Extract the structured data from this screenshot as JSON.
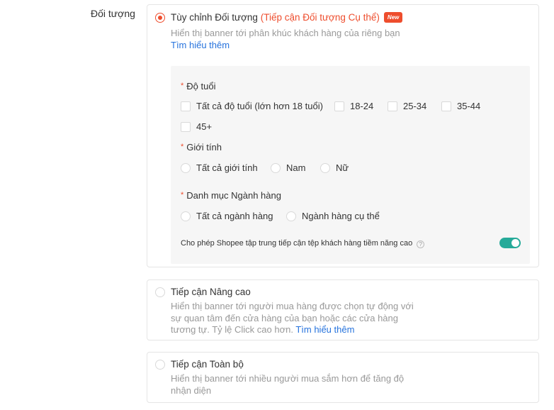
{
  "section_label": "Đối tượng",
  "option_custom": {
    "title_prefix": "Tùy chỉnh Đối tượng ",
    "title_accent": "(Tiếp cận Đối tượng Cụ thể)",
    "badge": "New",
    "description": "Hiển thị banner tới phân khúc khách hàng của riêng bạn",
    "link": "Tìm hiểu thêm",
    "age": {
      "label": "Độ tuổi",
      "options": [
        "Tất cả độ tuổi (lớn hơn 18 tuổi)",
        "18-24",
        "25-34",
        "35-44",
        "45+"
      ]
    },
    "gender": {
      "label": "Giới tính",
      "options": [
        "Tất cả giới tính",
        "Nam",
        "Nữ"
      ]
    },
    "category": {
      "label": "Danh mục Ngành hàng",
      "options": [
        "Tất cả ngành hàng",
        "Ngành hàng cụ thể"
      ]
    },
    "promo_text": "Cho phép Shopee tập trung tiếp cận tệp khách hàng tiềm năng cao",
    "help_glyph": "?",
    "required_mark": "*"
  },
  "option_advanced": {
    "title": "Tiếp cận Nâng cao",
    "desc_line1": "Hiển thị banner tới người mua hàng được chọn tự động với",
    "desc_line2": "sự quan tâm đến cửa hàng của bạn hoặc các cửa hàng",
    "desc_line3": "tương tự. Tỷ lệ Click cao hơn. ",
    "link": "Tìm hiểu thêm"
  },
  "option_all": {
    "title": "Tiếp cận Toàn bộ",
    "desc_line1": "Hiển thị banner tới nhiều người mua sắm hơn để tăng độ",
    "desc_line2": "nhận diện"
  },
  "colors": {
    "accent": "#ee4d2d",
    "link": "#2673dd",
    "toggle_on": "#26aa99"
  }
}
